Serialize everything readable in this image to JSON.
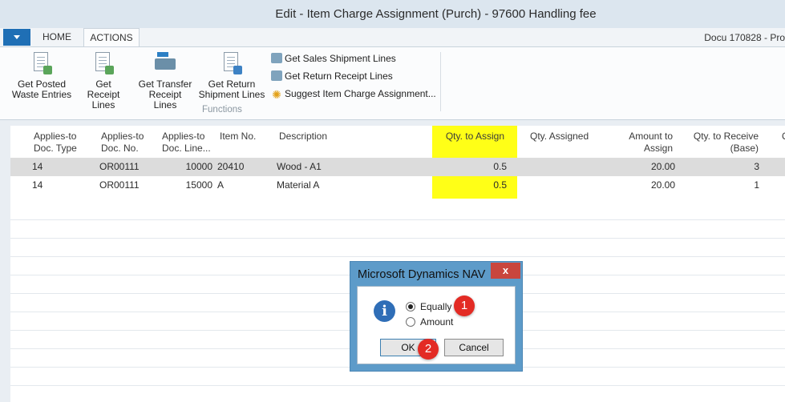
{
  "window": {
    "title": "Edit - Item Charge Assignment (Purch) - 97600 Handling fee",
    "doc_label": "Docu 170828 - Pro"
  },
  "ribbon": {
    "tabs": [
      "HOME",
      "ACTIONS"
    ],
    "active_tab": "ACTIONS",
    "buttons": [
      {
        "label1": "Get Posted",
        "label2": "Waste Entries",
        "icon": "posted-doc-icon"
      },
      {
        "label1": "Get",
        "label2": "Receipt Lines",
        "icon": "receipt-doc-icon"
      },
      {
        "label1": "Get Transfer",
        "label2": "Receipt Lines",
        "icon": "transfer-truck-icon"
      },
      {
        "label1": "Get Return",
        "label2": "Shipment Lines",
        "icon": "return-doc-icon"
      }
    ],
    "small_items": [
      {
        "label": "Get Sales Shipment Lines",
        "icon": "sales-shipment-icon"
      },
      {
        "label": "Get Return Receipt Lines",
        "icon": "return-receipt-icon"
      },
      {
        "label": "Suggest Item Charge Assignment...",
        "icon": "suggest-icon"
      }
    ],
    "group_label": "Functions"
  },
  "table": {
    "headers": {
      "applies_type": [
        "Applies-to",
        "Doc. Type"
      ],
      "applies_no": [
        "Applies-to",
        "Doc. No."
      ],
      "applies_line": [
        "Applies-to",
        "Doc. Line..."
      ],
      "item_no": "Item No.",
      "description": "Description",
      "qty_to_assign": "Qty. to Assign",
      "qty_assigned": "Qty. Assigned",
      "amount_to_assign": [
        "Amount to",
        "Assign"
      ],
      "qty_to_receive": [
        "Qty. to Receive",
        "(Base)"
      ],
      "next_partial": "Q"
    },
    "rows": [
      {
        "doc_type": "14",
        "doc_no": "OR00111",
        "line": "10000",
        "item": "20410",
        "description": "Wood - A1",
        "qty_to_assign": "0.5",
        "qty_assigned": "",
        "amount": "20.00",
        "qty_to_receive": "3"
      },
      {
        "doc_type": "14",
        "doc_no": "OR00111",
        "line": "15000",
        "item": "A",
        "description": "Material A",
        "qty_to_assign": "0.5",
        "qty_assigned": "",
        "amount": "20.00",
        "qty_to_receive": "1"
      }
    ],
    "highlight_color": "#ffff17"
  },
  "dialog": {
    "title": "Microsoft Dynamics NAV",
    "close_label": "x",
    "icon": "info-icon",
    "options": [
      {
        "label": "Equally",
        "selected": true
      },
      {
        "label": "Amount",
        "selected": false
      }
    ],
    "ok_label": "OK",
    "cancel_label": "Cancel",
    "step_markers": [
      "1",
      "2"
    ],
    "marker_color": "#e32b24"
  }
}
